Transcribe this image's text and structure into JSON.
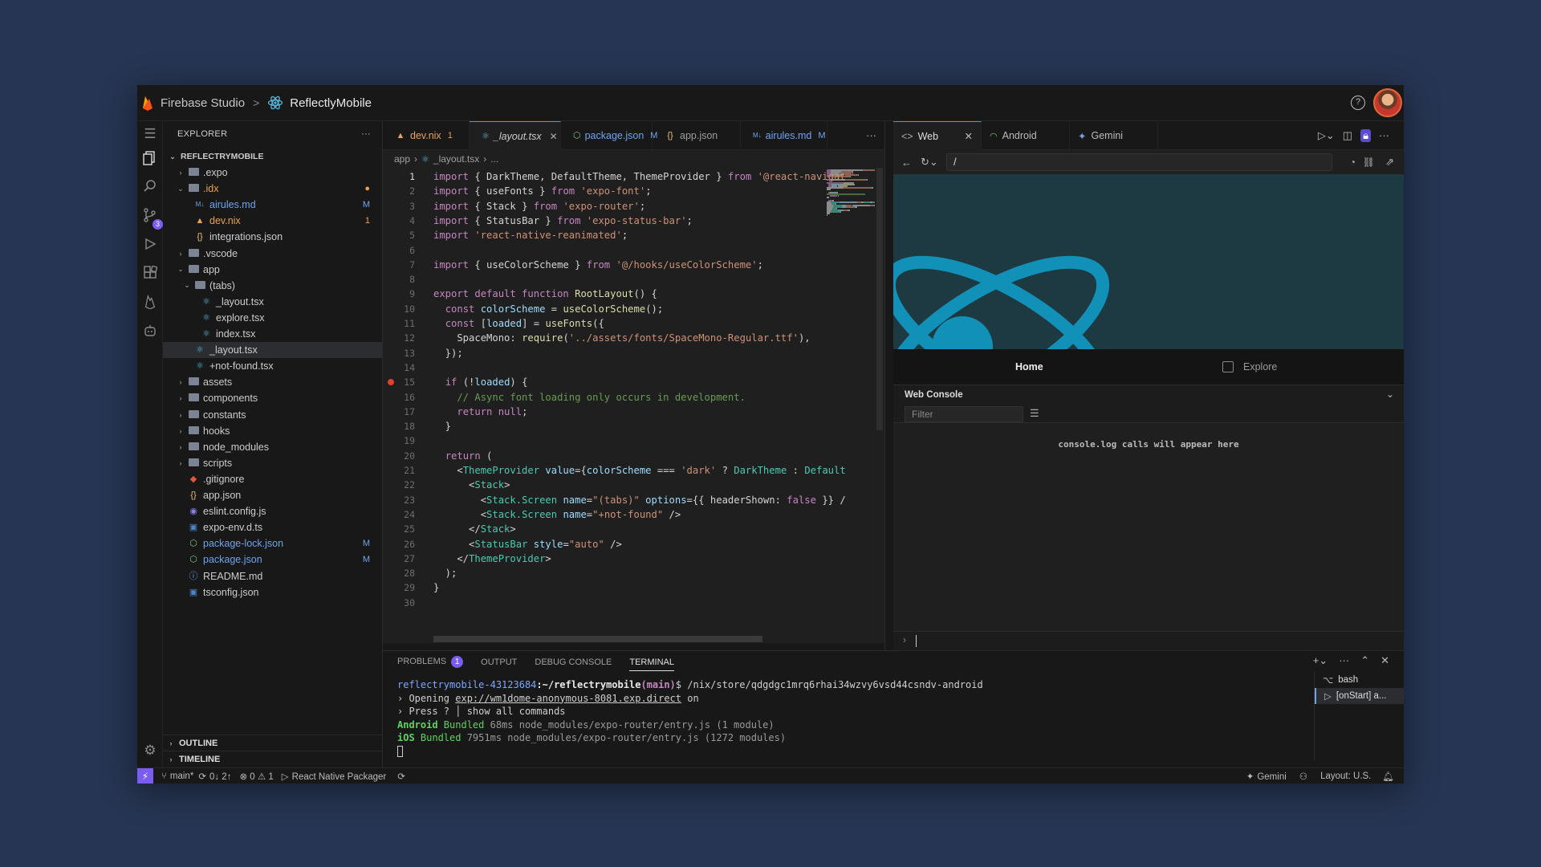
{
  "titlebar": {
    "brand": "Firebase Studio",
    "separator": ">",
    "project": "ReflectlyMobile",
    "help_label": "?"
  },
  "explorer": {
    "title": "EXPLORER",
    "more": "···",
    "root": "REFLECTRYMOBILE",
    "items": [
      {
        "label": ".expo",
        "type": "folder",
        "depth": 1,
        "expanded": false
      },
      {
        "label": ".idx",
        "type": "folder",
        "depth": 1,
        "expanded": true,
        "status": "●",
        "color": "#e8a155"
      },
      {
        "label": "airules.md",
        "type": "md",
        "depth": 2,
        "status": "M",
        "color": "#6ea3ef"
      },
      {
        "label": "dev.nix",
        "type": "nix",
        "depth": 2,
        "status": "1",
        "color": "#e8a155"
      },
      {
        "label": "integrations.json",
        "type": "json",
        "depth": 2
      },
      {
        "label": ".vscode",
        "type": "folder",
        "depth": 1,
        "expanded": false
      },
      {
        "label": "app",
        "type": "folder",
        "depth": 1,
        "expanded": true
      },
      {
        "label": "(tabs)",
        "type": "folder",
        "depth": 2,
        "expanded": true
      },
      {
        "label": "_layout.tsx",
        "type": "tsx",
        "depth": 3
      },
      {
        "label": "explore.tsx",
        "type": "tsx",
        "depth": 3
      },
      {
        "label": "index.tsx",
        "type": "tsx",
        "depth": 3
      },
      {
        "label": "_layout.tsx",
        "type": "tsx",
        "depth": 2,
        "selected": true
      },
      {
        "label": "+not-found.tsx",
        "type": "tsx",
        "depth": 2
      },
      {
        "label": "assets",
        "type": "folder",
        "depth": 1,
        "expanded": false
      },
      {
        "label": "components",
        "type": "folder",
        "depth": 1,
        "expanded": false
      },
      {
        "label": "constants",
        "type": "folder",
        "depth": 1,
        "expanded": false
      },
      {
        "label": "hooks",
        "type": "folder",
        "depth": 1,
        "expanded": false
      },
      {
        "label": "node_modules",
        "type": "folder",
        "depth": 1,
        "expanded": false
      },
      {
        "label": "scripts",
        "type": "folder",
        "depth": 1,
        "expanded": false
      },
      {
        "label": ".gitignore",
        "type": "git",
        "depth": 1
      },
      {
        "label": "app.json",
        "type": "json",
        "depth": 1
      },
      {
        "label": "eslint.config.js",
        "type": "eslint",
        "depth": 1
      },
      {
        "label": "expo-env.d.ts",
        "type": "ts",
        "depth": 1
      },
      {
        "label": "package-lock.json",
        "type": "npm",
        "depth": 1,
        "status": "M",
        "color": "#6ea3ef"
      },
      {
        "label": "package.json",
        "type": "npm",
        "depth": 1,
        "status": "M",
        "color": "#6ea3ef"
      },
      {
        "label": "README.md",
        "type": "info",
        "depth": 1
      },
      {
        "label": "tsconfig.json",
        "type": "tsconfig",
        "depth": 1
      }
    ],
    "outline": "OUTLINE",
    "timeline": "TIMELINE"
  },
  "editor": {
    "tabs": [
      {
        "label": "dev.nix",
        "badge": "1",
        "color": "#e8a155",
        "icon": "nix"
      },
      {
        "label": "_layout.tsx",
        "active": true,
        "icon": "tsx"
      },
      {
        "label": "package.json",
        "badge": "M",
        "color": "#6ea3ef",
        "icon": "npm"
      },
      {
        "label": "app.json",
        "icon": "json"
      },
      {
        "label": "airules.md",
        "badge": "M",
        "color": "#6ea3ef",
        "icon": "md"
      }
    ],
    "tabs_more": "···",
    "breadcrumb": {
      "folder": "app",
      "file": "_layout.tsx",
      "rest": "..."
    },
    "breakpoint_line": 15,
    "current_line": 1,
    "lines": [
      [
        [
          "k",
          "import"
        ],
        [
          "p",
          " { DarkTheme, DefaultTheme, ThemeProvider } "
        ],
        [
          "k",
          "from"
        ],
        [
          "s",
          " '@react-navigat"
        ]
      ],
      [
        [
          "k",
          "import"
        ],
        [
          "p",
          " { useFonts } "
        ],
        [
          "k",
          "from"
        ],
        [
          "s",
          " 'expo-font'"
        ],
        [
          "p",
          ";"
        ]
      ],
      [
        [
          "k",
          "import"
        ],
        [
          "p",
          " { Stack } "
        ],
        [
          "k",
          "from"
        ],
        [
          "s",
          " 'expo-router'"
        ],
        [
          "p",
          ";"
        ]
      ],
      [
        [
          "k",
          "import"
        ],
        [
          "p",
          " { StatusBar } "
        ],
        [
          "k",
          "from"
        ],
        [
          "s",
          " 'expo-status-bar'"
        ],
        [
          "p",
          ";"
        ]
      ],
      [
        [
          "k",
          "import"
        ],
        [
          "s",
          " 'react-native-reanimated'"
        ],
        [
          "p",
          ";"
        ]
      ],
      [],
      [
        [
          "k",
          "import"
        ],
        [
          "p",
          " { useColorScheme } "
        ],
        [
          "k",
          "from"
        ],
        [
          "s",
          " '@/hooks/useColorScheme'"
        ],
        [
          "p",
          ";"
        ]
      ],
      [],
      [
        [
          "k",
          "export default function"
        ],
        [
          "f",
          " RootLayout"
        ],
        [
          "p",
          "() {"
        ]
      ],
      [
        [
          "p",
          "  "
        ],
        [
          "k",
          "const"
        ],
        [
          "v",
          " colorScheme"
        ],
        [
          "p",
          " = "
        ],
        [
          "f",
          "useColorScheme"
        ],
        [
          "p",
          "();"
        ]
      ],
      [
        [
          "p",
          "  "
        ],
        [
          "k",
          "const"
        ],
        [
          "p",
          " ["
        ],
        [
          "v",
          "loaded"
        ],
        [
          "p",
          "] = "
        ],
        [
          "f",
          "useFonts"
        ],
        [
          "p",
          "({"
        ]
      ],
      [
        [
          "p",
          "    SpaceMono: "
        ],
        [
          "f",
          "require"
        ],
        [
          "p",
          "("
        ],
        [
          "s",
          "'../assets/fonts/SpaceMono-Regular.ttf'"
        ],
        [
          "p",
          "),"
        ]
      ],
      [
        [
          "p",
          "  });"
        ]
      ],
      [],
      [
        [
          "p",
          "  "
        ],
        [
          "k",
          "if"
        ],
        [
          "p",
          " (!"
        ],
        [
          "v",
          "loaded"
        ],
        [
          "p",
          ") {"
        ]
      ],
      [
        [
          "c",
          "    // Async font loading only occurs in development."
        ]
      ],
      [
        [
          "p",
          "    "
        ],
        [
          "k",
          "return null"
        ],
        [
          "p",
          ";"
        ]
      ],
      [
        [
          "p",
          "  }"
        ]
      ],
      [],
      [
        [
          "p",
          "  "
        ],
        [
          "k",
          "return"
        ],
        [
          "p",
          " ("
        ]
      ],
      [
        [
          "p",
          "    <"
        ],
        [
          "t",
          "ThemeProvider"
        ],
        [
          "a",
          " value"
        ],
        [
          "p",
          "={"
        ],
        [
          "v",
          "colorScheme"
        ],
        [
          "p",
          " === "
        ],
        [
          "s",
          "'dark'"
        ],
        [
          "p",
          " ? "
        ],
        [
          "t",
          "DarkTheme"
        ],
        [
          "p",
          " : "
        ],
        [
          "t",
          "Default"
        ]
      ],
      [
        [
          "p",
          "      <"
        ],
        [
          "t",
          "Stack"
        ],
        [
          "p",
          ">"
        ]
      ],
      [
        [
          "p",
          "        <"
        ],
        [
          "t",
          "Stack.Screen"
        ],
        [
          "a",
          " name"
        ],
        [
          "p",
          "="
        ],
        [
          "s",
          "\"(tabs)\""
        ],
        [
          "a",
          " options"
        ],
        [
          "p",
          "={{ headerShown: "
        ],
        [
          "k",
          "false"
        ],
        [
          "p",
          " }} /"
        ]
      ],
      [
        [
          "p",
          "        <"
        ],
        [
          "t",
          "Stack.Screen"
        ],
        [
          "a",
          " name"
        ],
        [
          "p",
          "="
        ],
        [
          "s",
          "\"+not-found\""
        ],
        [
          "p",
          " />"
        ]
      ],
      [
        [
          "p",
          "      </"
        ],
        [
          "t",
          "Stack"
        ],
        [
          "p",
          ">"
        ]
      ],
      [
        [
          "p",
          "      <"
        ],
        [
          "t",
          "StatusBar"
        ],
        [
          "a",
          " style"
        ],
        [
          "p",
          "="
        ],
        [
          "s",
          "\"auto\""
        ],
        [
          "p",
          " />"
        ]
      ],
      [
        [
          "p",
          "    </"
        ],
        [
          "t",
          "ThemeProvider"
        ],
        [
          "p",
          ">"
        ]
      ],
      [
        [
          "p",
          "  );"
        ]
      ],
      [
        [
          "p",
          "}"
        ]
      ],
      []
    ],
    "colors": {
      "k": "#c586c0",
      "p": "#d4d4d4",
      "s": "#ce9178",
      "f": "#dcdcaa",
      "v": "#9cdcfe",
      "c": "#6a9955",
      "t": "#4ec9b0",
      "a": "#9cdcfe"
    }
  },
  "preview": {
    "tabs": [
      {
        "label": "Web",
        "active": true
      },
      {
        "label": "Android"
      },
      {
        "label": "Gemini"
      }
    ],
    "url": "/",
    "app_tabs": {
      "home": "Home",
      "explore": "Explore"
    },
    "console": {
      "title": "Web Console",
      "filter_placeholder": "Filter",
      "empty": "console.log calls will appear here"
    }
  },
  "panel": {
    "tabs": [
      "PROBLEMS",
      "OUTPUT",
      "DEBUG CONSOLE",
      "TERMINAL"
    ],
    "problems_count": "1",
    "active": "TERMINAL",
    "terminal": {
      "prompt_host": "reflectrymobile-43123684",
      "prompt_path": ":~/reflectrymobile",
      "prompt_branch": "(main)",
      "prompt_rest": "$ /nix/store/qdgdgc1mrq6rhai34wzvy6vsd44csndv-android",
      "line2a": "› Opening ",
      "line2b": "exp://wm1dome-anonymous-8081.exp.direct",
      "line2c": " on",
      "line3": "› Press ? │ show all commands",
      "line4a": "Android",
      "line4b": " Bundled",
      "line4c": " 68ms node_modules/expo-router/entry.js (1 module)",
      "line5a": "iOS",
      "line5b": " Bundled",
      "line5c": " 7951ms node_modules/expo-router/entry.js (1272 modules)"
    },
    "terminals": [
      {
        "label": "bash"
      },
      {
        "label": "[onStart] a..."
      }
    ]
  },
  "statusbar": {
    "branch": "main*",
    "sync": "0↓ 2↑",
    "problems": "⊗ 0 ⚠ 1",
    "task": "React Native Packager",
    "gemini": "Gemini",
    "layout": "Layout: U.S."
  }
}
